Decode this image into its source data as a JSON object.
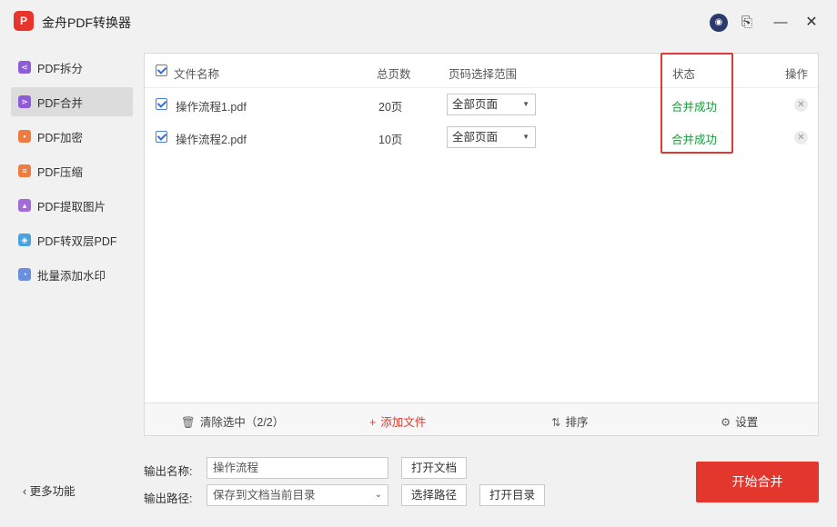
{
  "app": {
    "logo_text": "P",
    "title": "金舟PDF转换器"
  },
  "titlebar": {
    "avatar_text": "◉",
    "notes_text": "⎘",
    "min_text": "—",
    "close_text": "✕"
  },
  "sidebar": {
    "items": [
      {
        "label": "PDF拆分",
        "icon": "split-icon",
        "color": "#8e5cd9"
      },
      {
        "label": "PDF合并",
        "icon": "merge-icon",
        "color": "#8e5cd9"
      },
      {
        "label": "PDF加密",
        "icon": "lock-icon",
        "color": "#f07b3f"
      },
      {
        "label": "PDF压缩",
        "icon": "compress-icon",
        "color": "#f07b3f"
      },
      {
        "label": "PDF提取图片",
        "icon": "image-icon",
        "color": "#a46ad8"
      },
      {
        "label": "PDF转双层PDF",
        "icon": "layers-icon",
        "color": "#4aa3df"
      },
      {
        "label": "批量添加水印",
        "icon": "watermark-icon",
        "color": "#6b8fe0"
      }
    ],
    "more_label": "更多功能"
  },
  "table": {
    "headers": {
      "name": "文件名称",
      "pages": "总页数",
      "range": "页码选择范围",
      "status": "状态",
      "action": "操作"
    },
    "rows": [
      {
        "name": "操作流程1.pdf",
        "pages": "20页",
        "range": "全部页面",
        "status": "合并成功"
      },
      {
        "name": "操作流程2.pdf",
        "pages": "10页",
        "range": "全部页面",
        "status": "合并成功"
      }
    ]
  },
  "toolbar": {
    "clear_label": "清除选中（2/2）",
    "add_label": "添加文件",
    "sort_label": "排序",
    "settings_label": "设置"
  },
  "output": {
    "name_label": "输出名称:",
    "name_value": "操作流程",
    "path_label": "输出路径:",
    "path_value": "保存到文档当前目录",
    "open_doc_label": "打开文档",
    "choose_path_label": "选择路径",
    "open_dir_label": "打开目录"
  },
  "start_label": "开始合并",
  "colors": {
    "accent": "#e3362c",
    "success": "#1a9a3c",
    "checkbox": "#2f6fe0"
  }
}
